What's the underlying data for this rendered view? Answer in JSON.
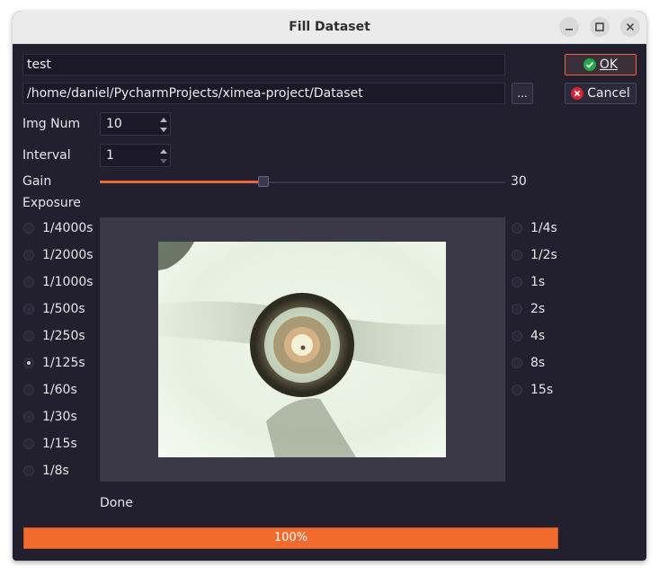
{
  "window": {
    "title": "Fill Dataset"
  },
  "form": {
    "name_value": "test",
    "path_value": "/home/daniel/PycharmProjects/ximea-project/Dataset",
    "browse_label": "...",
    "img_num_label": "Img Num",
    "img_num_value": "10",
    "interval_label": "Interval",
    "interval_value": "1",
    "gain_label": "Gain",
    "gain_value": "30",
    "gain_fraction": 0.4,
    "exposure_label": "Exposure"
  },
  "buttons": {
    "ok_label": "OK",
    "cancel_label": "Cancel"
  },
  "exposure_left": [
    "1/4000s",
    "1/2000s",
    "1/1000s",
    "1/500s",
    "1/250s",
    "1/125s",
    "1/60s",
    "1/30s",
    "1/15s",
    "1/8s"
  ],
  "exposure_right": [
    "1/4s",
    "1/2s",
    "1s",
    "2s",
    "4s",
    "8s",
    "15s"
  ],
  "exposure_selected": "1/125s",
  "status": {
    "text": "Done",
    "progress_text": "100%",
    "progress": 1.0
  },
  "colors": {
    "accent": "#f26b2e",
    "background": "#221f2e",
    "ok_icon": "#22a74a",
    "cancel_icon": "#d62333"
  }
}
